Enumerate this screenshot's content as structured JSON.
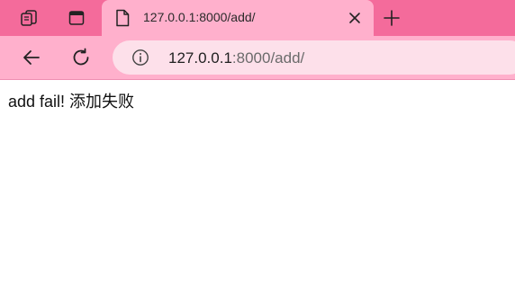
{
  "browser": {
    "tab": {
      "title": "127.0.0.1:8000/add/"
    },
    "address_bar": {
      "host": "127.0.0.1",
      "rest": ":8000/add/"
    },
    "icons": {
      "workspaces": "workspaces-icon",
      "tab_actions": "tab-actions-icon",
      "page": "page-icon",
      "close": "close-icon",
      "new_tab": "plus-icon",
      "back": "back-arrow-icon",
      "refresh": "refresh-icon",
      "site_info": "info-icon"
    },
    "colors": {
      "tabbar": "#f46b9b",
      "active_tab": "#ffb0cc",
      "omnibox": "#fde0ea"
    }
  },
  "page": {
    "message": "add fail! 添加失败"
  }
}
